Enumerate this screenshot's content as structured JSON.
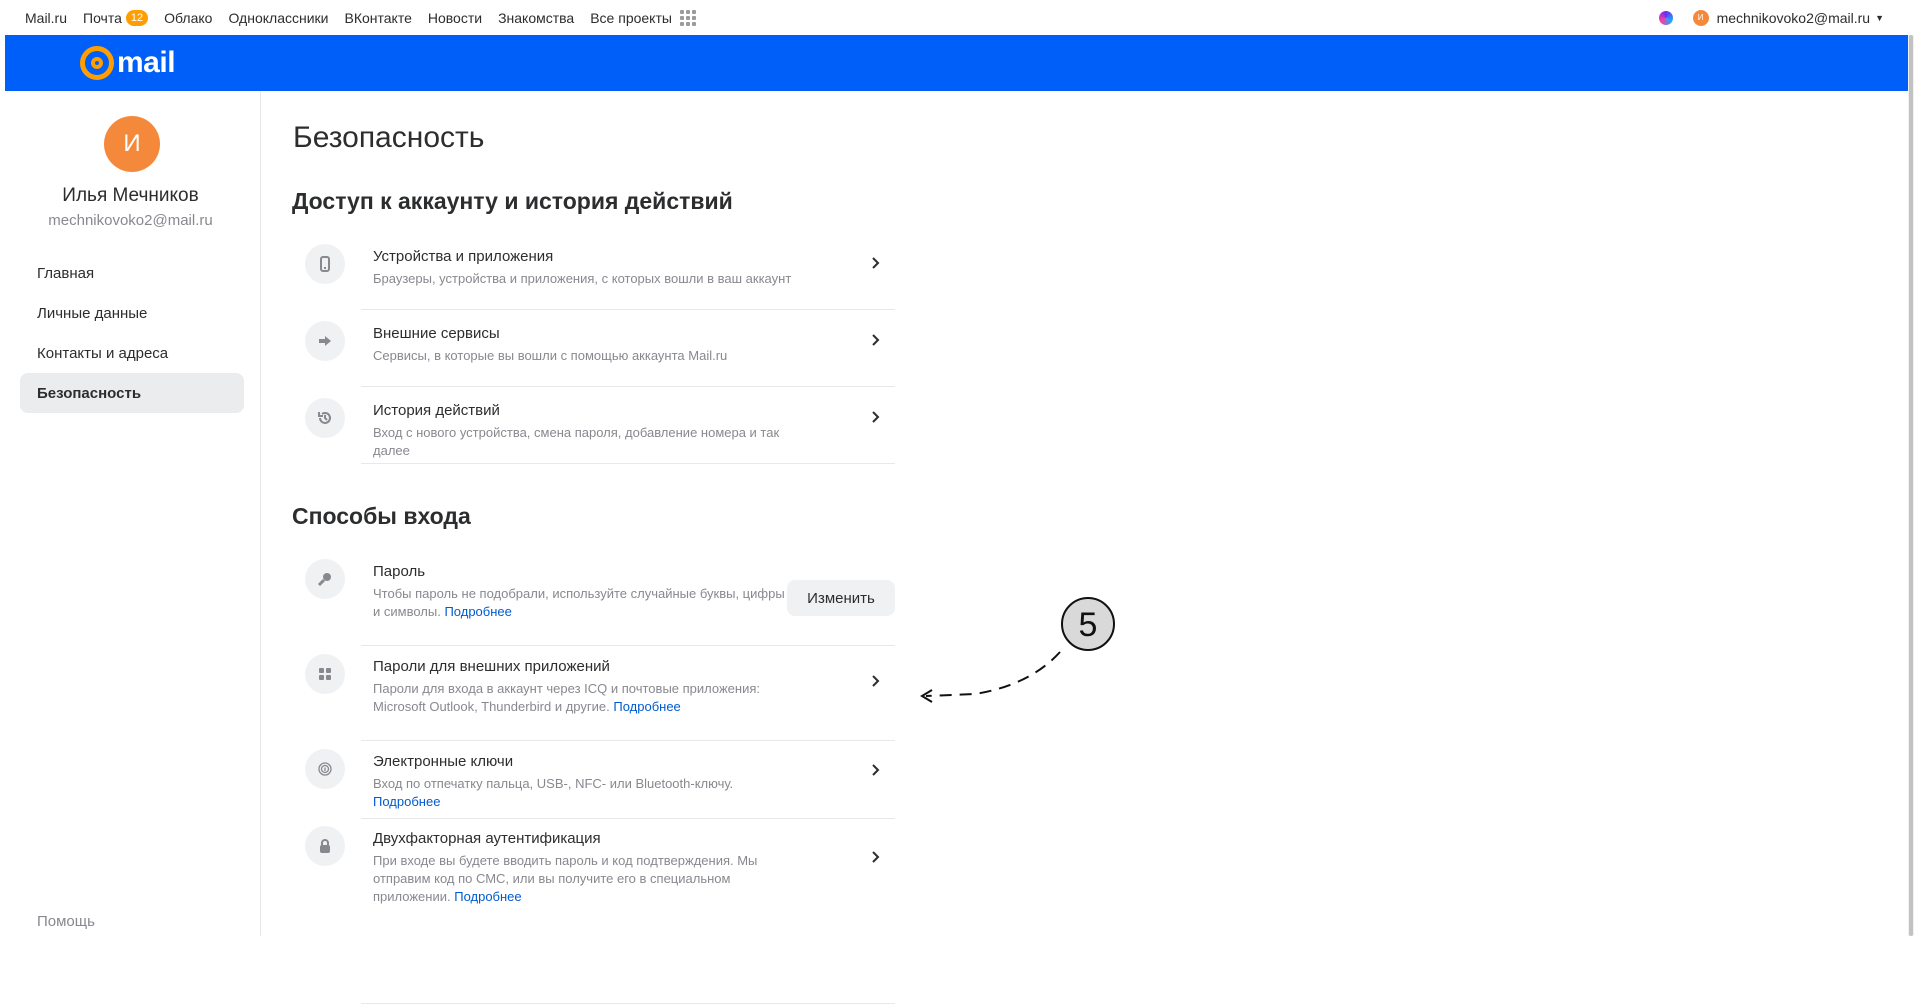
{
  "topbar": {
    "links": [
      {
        "label": "Mail.ru"
      },
      {
        "label": "Почта",
        "badge": "12"
      },
      {
        "label": "Облако"
      },
      {
        "label": "Одноклассники"
      },
      {
        "label": "ВКонтакте"
      },
      {
        "label": "Новости"
      },
      {
        "label": "Знакомства"
      },
      {
        "label": "Все проекты"
      }
    ],
    "avatar_letter": "И",
    "account_email": "mechnikovoko2@mail.ru"
  },
  "header": {
    "logo_text": "mail"
  },
  "profile": {
    "avatar_letter": "И",
    "name": "Илья Мечников",
    "email": "mechnikovoko2@mail.ru"
  },
  "sidebar": {
    "items": [
      {
        "label": "Главная"
      },
      {
        "label": "Личные данные"
      },
      {
        "label": "Контакты и адреса"
      },
      {
        "label": "Безопасность",
        "active": true
      }
    ],
    "help": "Помощь"
  },
  "page": {
    "title": "Безопасность",
    "sections": [
      {
        "title": "Доступ к аккаунту и история действий",
        "rows": [
          {
            "icon": "phone-icon",
            "title": "Устройства и приложения",
            "desc": "Браузеры, устройства и приложения, с которых вошли в ваш аккаунт"
          },
          {
            "icon": "arrow-right-icon",
            "title": "Внешние сервисы",
            "desc": "Сервисы, в которые вы вошли с помощью аккаунта Mail.ru"
          },
          {
            "icon": "history-icon",
            "title": "История действий",
            "desc": "Вход с нового устройства, смена пароля, добавление номера и так далее"
          }
        ]
      },
      {
        "title": "Способы входа",
        "rows": [
          {
            "icon": "key-icon",
            "title": "Пароль",
            "desc": "Чтобы пароль не подобрали, используйте случайные буквы, цифры и символы.",
            "more": "Подробнее",
            "button": "Изменить"
          },
          {
            "icon": "apps-grid-icon",
            "title": "Пароли для внешних приложений",
            "desc": "Пароли для входа в аккаунт через ICQ и почтовые приложения: Microsoft Outlook, Thunderbird и другие.",
            "more": "Подробнее"
          },
          {
            "icon": "fingerprint-icon",
            "title": "Электронные ключи",
            "desc": "Вход по отпечатку пальца, USB-, NFC- или Bluetooth-ключу.",
            "more": "Подробнее"
          },
          {
            "icon": "lock-icon",
            "title": "Двухфакторная аутентификация",
            "desc": "При входе вы будете вводить пароль и код подтверждения. Мы отправим код по СМС, или вы получите его в специальном приложении.",
            "more": "Подробнее"
          }
        ]
      }
    ]
  },
  "annotation": {
    "number": "5"
  }
}
